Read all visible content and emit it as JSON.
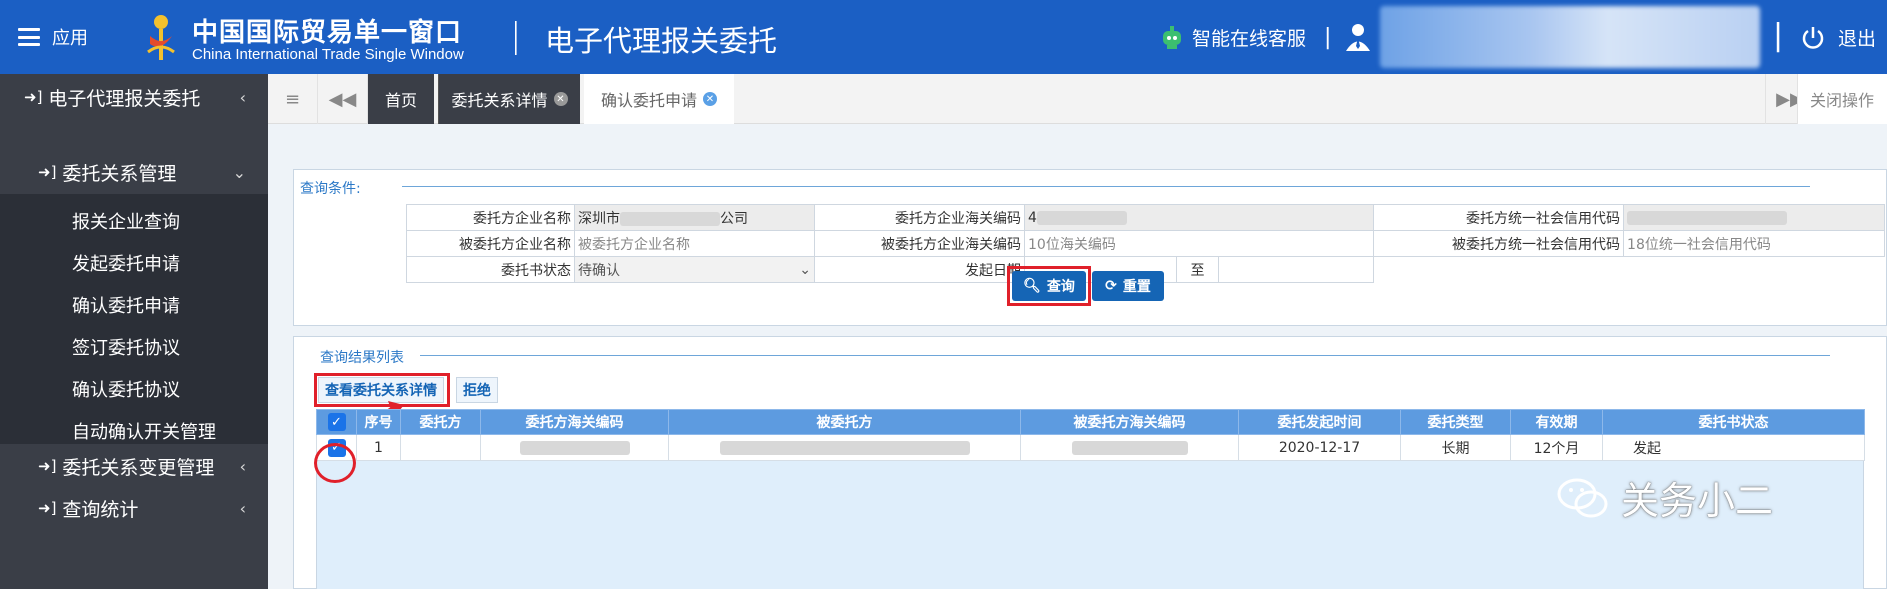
{
  "header": {
    "menu_label": "应用",
    "logo_cn": "中国国际贸易单一窗口",
    "logo_en": "China International Trade Single Window",
    "separator": "|",
    "system_title": "电子代理报关委托",
    "customer_service": "智能在线客服",
    "pipe": "|",
    "logout": "退出"
  },
  "sidebar": {
    "top_item": "电子代理报关委托",
    "group1": "委托关系管理",
    "leaves": [
      "报关企业查询",
      "发起委托申请",
      "确认委托申请",
      "签订委托协议",
      "确认委托协议",
      "自动确认开关管理"
    ],
    "group2": "委托关系变更管理",
    "group3": "查询统计"
  },
  "tabs": {
    "home": "首页",
    "tab1": "委托关系详情",
    "tab2": "确认委托申请",
    "close_ops": "关闭操作"
  },
  "query": {
    "legend": "查询条件:",
    "labels": {
      "client_name": "委托方企业名称",
      "client_code": "委托方企业海关编码",
      "client_credit": "委托方统一社会信用代码",
      "agent_name": "被委托方企业名称",
      "agent_code": "被委托方企业海关编码",
      "agent_credit": "被委托方统一社会信用代码",
      "status": "委托书状态",
      "date": "发起日期",
      "to": "至"
    },
    "values": {
      "client_name_pre": "深圳市",
      "client_name_post": "公司",
      "client_code_pre": "4"
    },
    "placeholders": {
      "agent_name": "被委托方企业名称",
      "agent_code": "10位海关编码",
      "agent_credit": "18位统一社会信用代码"
    },
    "status_value": "待确认",
    "search_btn": "查询",
    "reset_btn": "重置"
  },
  "results": {
    "legend": "查询结果列表",
    "view_detail_btn": "查看委托关系详情",
    "reject_btn": "拒绝",
    "columns": [
      "序号",
      "委托方",
      "委托方海关编码",
      "被委托方",
      "被委托方海关编码",
      "委托发起时间",
      "委托类型",
      "有效期",
      "委托书状态"
    ],
    "rows": [
      {
        "index": "1",
        "start_time": "2020-12-17",
        "type": "长期",
        "validity": "12个月",
        "status": "发起"
      }
    ]
  },
  "watermark": "关务小二",
  "colors": {
    "header_bg": "#1b5fc4",
    "sidebar_bg": "#3a3e47",
    "table_header": "#5d9be0",
    "button_blue": "#1565b5",
    "highlight_red": "#e0202a"
  }
}
